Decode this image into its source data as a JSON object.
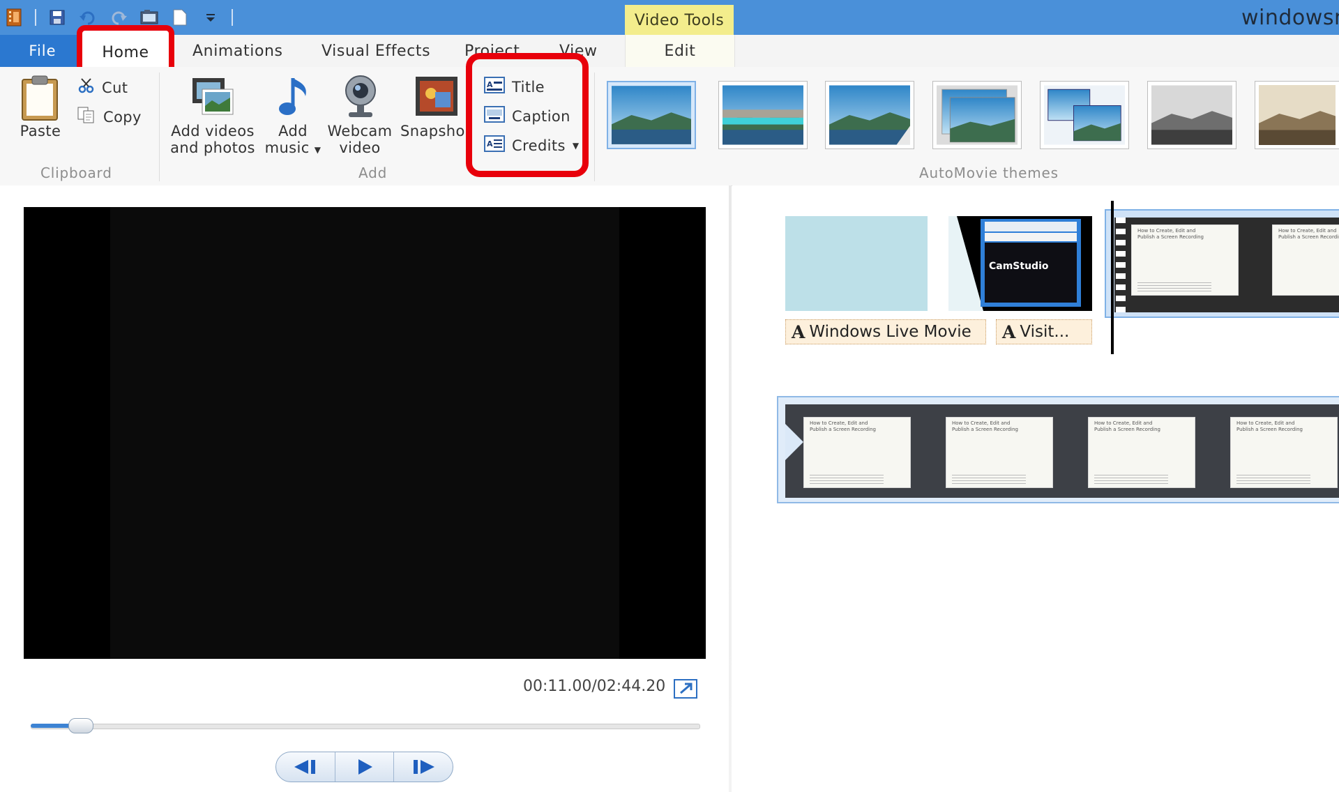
{
  "window": {
    "title": "windowsn",
    "context_tab": "Video Tools"
  },
  "tabs": [
    {
      "label": "File"
    },
    {
      "label": "Home"
    },
    {
      "label": "Animations"
    },
    {
      "label": "Visual Effects"
    },
    {
      "label": "Project"
    },
    {
      "label": "View"
    },
    {
      "label": "Edit"
    }
  ],
  "ribbon": {
    "clipboard": {
      "group_label": "Clipboard",
      "paste": "Paste",
      "cut": "Cut",
      "copy": "Copy"
    },
    "add": {
      "group_label": "Add",
      "add_videos_line1": "Add videos",
      "add_videos_line2": "and photos",
      "add_music_line1": "Add",
      "add_music_line2": "music",
      "webcam_line1": "Webcam",
      "webcam_line2": "video",
      "snapshot": "Snapsho"
    },
    "text": {
      "title": "Title",
      "caption": "Caption",
      "credits": "Credits"
    },
    "themes": {
      "group_label": "AutoMovie themes",
      "count": 7
    }
  },
  "preview": {
    "timecode": "00:11.00/02:44.20",
    "progress_fraction": 0.067
  },
  "storyboard": {
    "row1_captions": [
      {
        "text": "Windows Live Movie"
      },
      {
        "text": "Visit..."
      }
    ],
    "clip_thumb": {
      "camstudio_label": "CamStudio",
      "slide_title_line1": "How to Create, Edit and",
      "slide_title_line2": "Publish a Screen Recording"
    }
  },
  "icons": {
    "qat": [
      "movie-maker-icon",
      "save-icon",
      "undo-icon",
      "redo-icon",
      "snapshot-icon",
      "new-project-icon",
      "customize-qat-icon"
    ],
    "colors": {
      "accent": "#2b78d0",
      "titlebar": "#4a90d9",
      "context_tab": "#f3ed8c",
      "highlight_box": "#e8000b"
    }
  }
}
